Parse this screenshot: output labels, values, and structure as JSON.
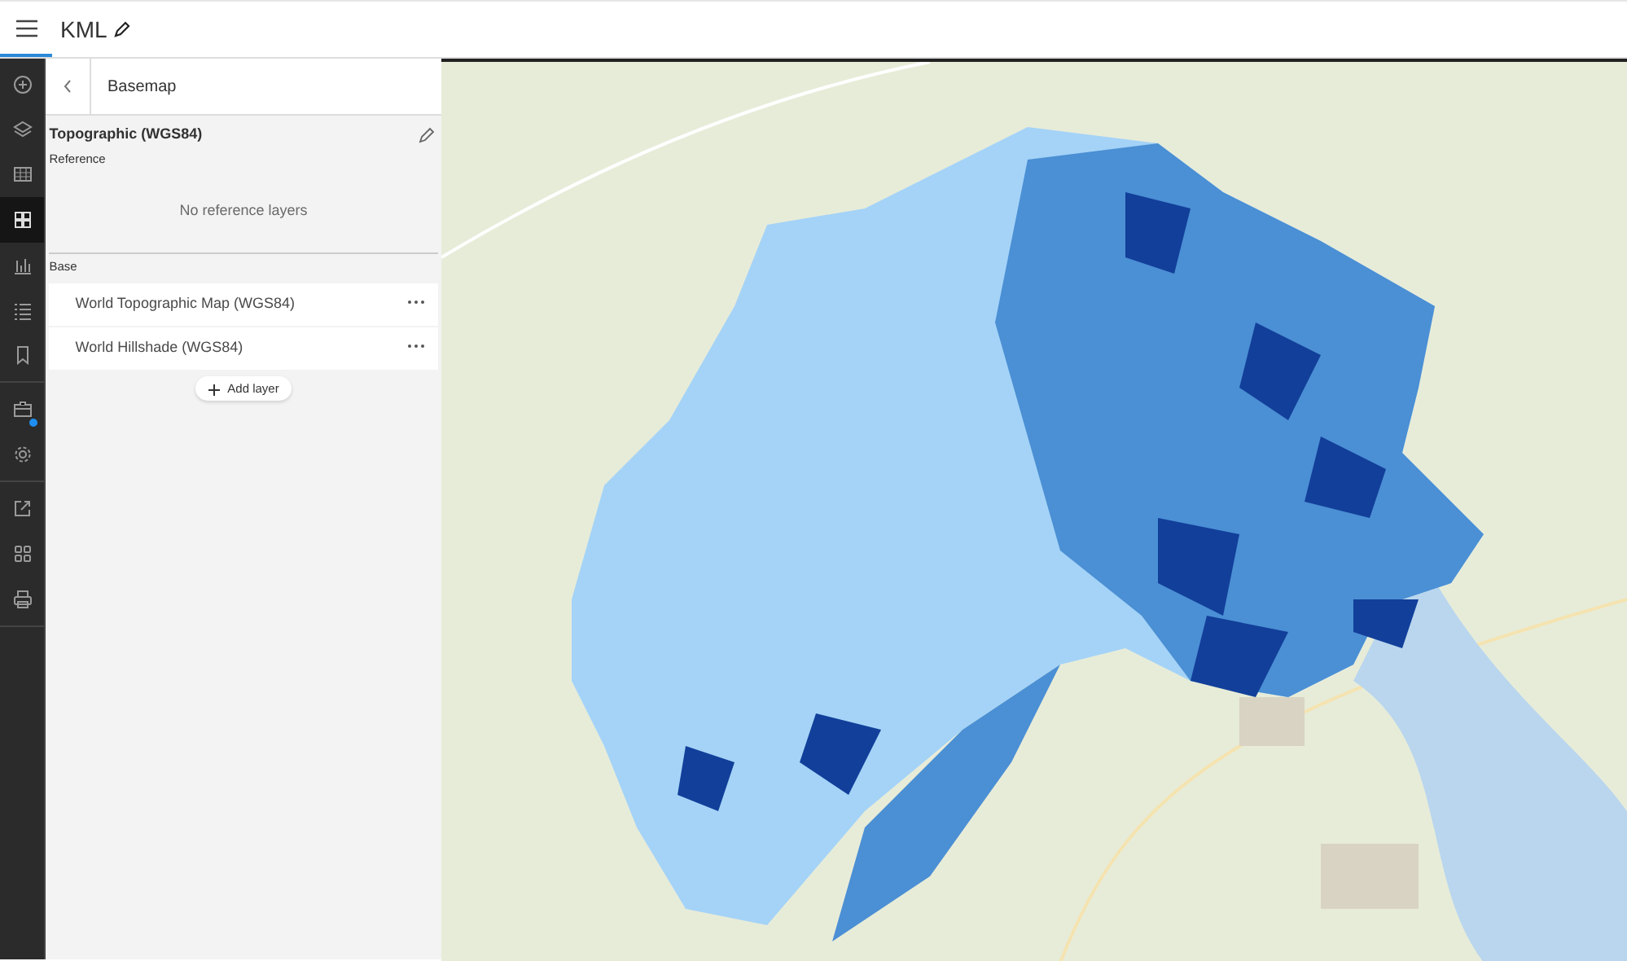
{
  "header": {
    "title": "KML"
  },
  "rail": {
    "groups": [
      {
        "items": [
          {
            "kind": "add",
            "selected": false,
            "notification": false
          },
          {
            "kind": "layers",
            "selected": false,
            "notification": false
          },
          {
            "kind": "table",
            "selected": false,
            "notification": false
          },
          {
            "kind": "basemap",
            "selected": true,
            "notification": false
          },
          {
            "kind": "chart",
            "selected": false,
            "notification": false
          },
          {
            "kind": "legend",
            "selected": false,
            "notification": false
          },
          {
            "kind": "bookmark",
            "selected": false,
            "notification": false
          }
        ]
      },
      {
        "items": [
          {
            "kind": "briefcase",
            "selected": false,
            "notification": true
          },
          {
            "kind": "gear",
            "selected": false,
            "notification": false
          }
        ]
      },
      {
        "items": [
          {
            "kind": "share",
            "selected": false,
            "notification": false
          },
          {
            "kind": "grid",
            "selected": false,
            "notification": false
          },
          {
            "kind": "print",
            "selected": false,
            "notification": false
          }
        ]
      }
    ]
  },
  "panel": {
    "title": "Basemap",
    "basemap_name": "Topographic (WGS84)",
    "reference_label": "Reference",
    "reference_empty": "No reference layers",
    "base_label": "Base",
    "base_layers": [
      {
        "name": "World Topographic Map (WGS84)"
      },
      {
        "name": "World Hillshade (WGS84)"
      }
    ],
    "add_button": "Add layer"
  }
}
